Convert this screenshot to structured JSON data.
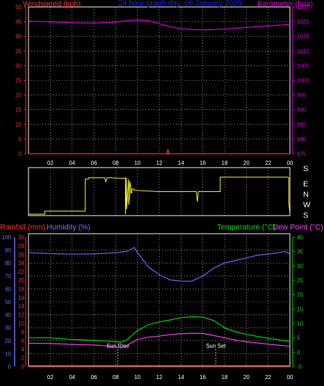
{
  "colors": {
    "wind": "#ff3030",
    "baro": "#e000e0",
    "title": "#2020ff",
    "rain": "#ff3030",
    "hum": "#7070ff",
    "temp": "#00e000",
    "dew": "#ff40ff",
    "winddir": "#ffff30",
    "grid": "#ffffff",
    "axis": "#ffffff",
    "sunline": "#ffff30"
  },
  "chart_data": [
    {
      "type": "line",
      "title": "24 hour graph day: 06 January 2025",
      "ylabel_left": "Windspeed (kph)",
      "ylabel_right": "Barometer (hpa)",
      "x_ticks": [
        "02",
        "04",
        "06",
        "08",
        "10",
        "12",
        "14",
        "16",
        "18",
        "20",
        "22",
        "00"
      ],
      "xlim": [
        0,
        24
      ],
      "ylim_left": [
        0,
        50
      ],
      "ylim_right": [
        975,
        1025
      ],
      "y_ticks_left": [
        0,
        5,
        10,
        15,
        20,
        25,
        30,
        35,
        40,
        45,
        50
      ],
      "y_ticks_right": [
        975,
        980,
        985,
        990,
        995,
        1000,
        1005,
        1010,
        1015,
        1020,
        1025
      ],
      "series": [
        {
          "name": "Windspeed (kph)",
          "axis": "left",
          "x": [
            0,
            12.7,
            12.8,
            12.9,
            24
          ],
          "y": [
            0,
            0,
            1.5,
            0,
            0
          ]
        },
        {
          "name": "Barometer (hpa)",
          "axis": "right",
          "x": [
            0,
            2,
            4,
            6,
            8,
            9,
            10,
            11,
            12,
            13,
            14,
            15,
            16,
            17,
            18,
            20,
            22,
            24
          ],
          "y": [
            1020.2,
            1019.9,
            1019.6,
            1019.5,
            1019.8,
            1020.3,
            1020.6,
            1020.3,
            1019.3,
            1018.3,
            1017.6,
            1017.3,
            1017.2,
            1017.3,
            1017.5,
            1018.0,
            1018.6,
            1019.0
          ]
        }
      ]
    },
    {
      "type": "line",
      "direction_labels": [
        "S",
        "E",
        "N",
        "W",
        "S"
      ],
      "xlim": [
        0,
        24
      ],
      "ylim": [
        0,
        360
      ],
      "series": [
        {
          "name": "Wind direction",
          "x": [
            0,
            1.5,
            1.5,
            5.2,
            5.2,
            5.5,
            5.5,
            7.0,
            7.1,
            7.2,
            7.3,
            8.8,
            8.9,
            8.9,
            9.0,
            9.0,
            9.2,
            9.2,
            9.3,
            9.3,
            9.4,
            9.4,
            9.5,
            9.5,
            9.7,
            9.7,
            12.0,
            14.0,
            15.4,
            15.5,
            15.6,
            17.5,
            17.6,
            17.6,
            23.8,
            23.9,
            23.9,
            24.0
          ],
          "y": [
            0,
            0,
            25,
            25,
            280,
            280,
            290,
            290,
            255,
            290,
            290,
            285,
            290,
            0,
            290,
            40,
            280,
            75,
            160,
            260,
            210,
            170,
            170,
            200,
            200,
            190,
            180,
            180,
            180,
            100,
            180,
            180,
            180,
            295,
            295,
            290,
            90,
            5
          ]
        }
      ]
    },
    {
      "type": "line",
      "ylabel_left1": "Rainfall (mm)",
      "ylabel_left2": "Humidity (%)",
      "ylabel_right1": "Temperature (°C)",
      "ylabel_right2": "Dew Point (°C)",
      "x_ticks": [
        "02",
        "04",
        "06",
        "08",
        "10",
        "12",
        "14",
        "16",
        "18",
        "20",
        "22",
        "00"
      ],
      "xlim": [
        0,
        24
      ],
      "humidity_ticks": [
        0,
        10,
        20,
        30,
        40,
        50,
        60,
        70,
        80,
        90,
        100
      ],
      "rain_ticks": [
        0,
        2,
        4,
        6,
        8,
        10,
        12,
        14,
        16,
        18,
        20,
        22,
        24,
        26,
        28,
        30
      ],
      "temp_ticks": [
        -5,
        0,
        5,
        10,
        15,
        20,
        25,
        30,
        35,
        40
      ],
      "ylim_humidity": [
        0,
        100
      ],
      "ylim_temp": [
        -5,
        40
      ],
      "annotations": [
        {
          "text": "Sun Rise",
          "x": 8.2
        },
        {
          "text": "Sun Set",
          "x": 17.2
        }
      ],
      "series": [
        {
          "name": "Humidity (%)",
          "x": [
            0,
            3,
            6,
            8,
            9,
            9.7,
            10,
            11,
            12,
            13,
            14,
            14.5,
            15,
            16,
            17,
            18,
            19,
            20,
            21,
            22,
            23,
            23.5,
            24
          ],
          "y": [
            88,
            87,
            87,
            88,
            89,
            92,
            88,
            77,
            71,
            67,
            66,
            66,
            66,
            70,
            76,
            80,
            82,
            84,
            86,
            87,
            88,
            89,
            87
          ]
        },
        {
          "name": "Temperature (°C)",
          "x": [
            0,
            2,
            4,
            6,
            7,
            8,
            8.5,
            9,
            10,
            11,
            12,
            13,
            14,
            15,
            16,
            17,
            18,
            19,
            20,
            21,
            22,
            23,
            24
          ],
          "y": [
            5,
            5,
            4.4,
            4.1,
            3.9,
            3.6,
            3.5,
            4.2,
            7.5,
            9.5,
            10.5,
            11.2,
            12.0,
            12.3,
            12.2,
            11.0,
            8.5,
            7.1,
            6.2,
            5.5,
            4.8,
            4.3,
            3.7
          ]
        },
        {
          "name": "Dew Point (°C)",
          "x": [
            0,
            2,
            4,
            6,
            7,
            8,
            8.5,
            9,
            10,
            11,
            12,
            13,
            14,
            15,
            16,
            17,
            18,
            19,
            20,
            21,
            22,
            23,
            24
          ],
          "y": [
            3.1,
            3.0,
            2.7,
            2.5,
            2.2,
            1.8,
            1.5,
            2.3,
            4.4,
            5.2,
            5.6,
            6.1,
            6.4,
            6.6,
            6.5,
            5.8,
            5.0,
            4.2,
            3.6,
            3.2,
            2.8,
            2.4,
            2.1
          ]
        },
        {
          "name": "Rainfall (mm)",
          "x": [
            0,
            24
          ],
          "y": [
            0,
            0
          ]
        }
      ]
    }
  ]
}
